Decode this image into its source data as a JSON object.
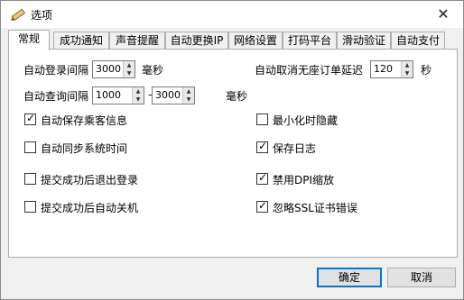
{
  "window": {
    "title": "选项",
    "close_glyph": "✕"
  },
  "tabs": [
    {
      "label": "常规",
      "active": true
    },
    {
      "label": "成功通知"
    },
    {
      "label": "声音提醒"
    },
    {
      "label": "自动更换IP"
    },
    {
      "label": "网络设置"
    },
    {
      "label": "打码平台"
    },
    {
      "label": "滑动验证"
    },
    {
      "label": "自动支付"
    }
  ],
  "general": {
    "auto_login_interval": {
      "label": "自动登录间隔",
      "value": "3000",
      "unit": "毫秒"
    },
    "auto_query_interval": {
      "label": "自动查询间隔",
      "min": "1000",
      "separator": "–",
      "max": "3000",
      "unit": "毫秒"
    },
    "auto_cancel_delay": {
      "label": "自动取消无座订单延迟",
      "value": "120",
      "unit": "秒"
    },
    "checkboxes_left": [
      {
        "label": "自动保存乘客信息",
        "checked": true
      },
      {
        "label": "自动同步系统时间",
        "checked": false
      },
      {
        "label": "提交成功后退出登录",
        "checked": false
      },
      {
        "label": "提交成功后自动关机",
        "checked": false
      }
    ],
    "checkboxes_right": [
      {
        "label": "最小化时隐藏",
        "checked": false
      },
      {
        "label": "保存日志",
        "checked": true
      },
      {
        "label": "禁用DPI缩放",
        "checked": true
      },
      {
        "label": "忽略SSL证书错误",
        "checked": true
      }
    ]
  },
  "buttons": {
    "ok": "确定",
    "cancel": "取消"
  },
  "icons": {
    "title_icon": "pencil-icon",
    "spin_up": "▲",
    "spin_down": "▼",
    "check": "✓"
  }
}
